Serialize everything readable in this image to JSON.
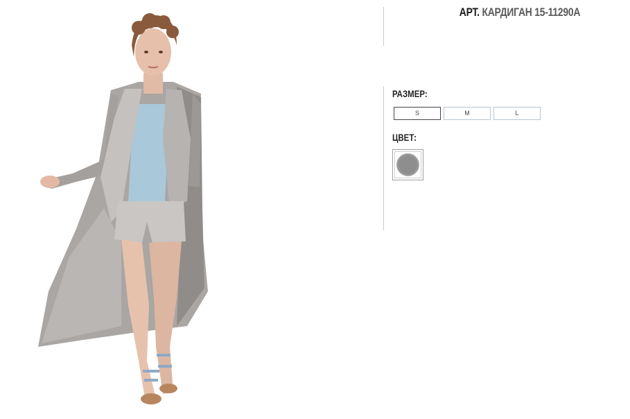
{
  "product": {
    "art_prefix": "АРТ.",
    "name": "КАРДИГАН 15-11290А"
  },
  "size": {
    "label": "РАЗМЕР:",
    "options": [
      "S",
      "M",
      "L"
    ],
    "selected": "S"
  },
  "color": {
    "label": "ЦВЕТ:",
    "swatch_color": "#8e8e8e"
  }
}
